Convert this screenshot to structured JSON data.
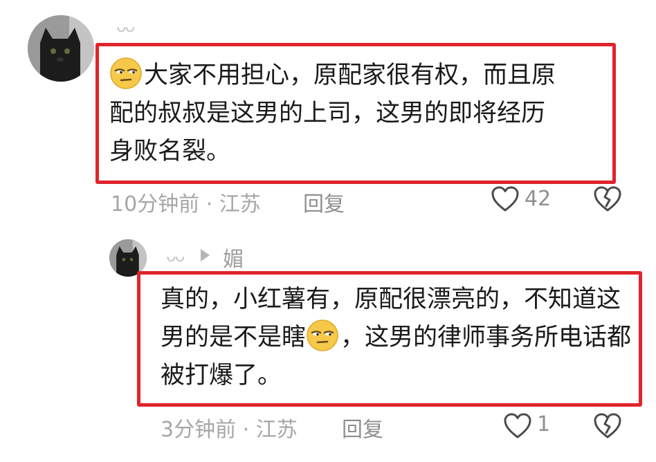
{
  "comment": {
    "author_mark": "ᴗᴗ",
    "text_lines": [
      "大家不用担心，原配家很有权，而且原",
      "配的叔叔是这男的上司，这男的即将经历",
      "身败名裂。"
    ],
    "time": "10分钟前 · 江苏",
    "reply_label": "回复",
    "likes": "42",
    "emoji": "smirk-face-icon"
  },
  "reply": {
    "author_mark": "ᴗᴗ",
    "reply_to": "媚",
    "text_before_emoji": "真的，小红薯有，原配很漂亮的，不知道这男的是不是瞎",
    "text_after_emoji": "，这男的律师事务所电话都被打爆了。",
    "time": "3分钟前 · 江苏",
    "reply_label": "回复",
    "likes": "1",
    "emoji": "smirk-face-icon"
  },
  "colors": {
    "highlight_border": "#e0242c",
    "meta_text": "#a6a6a6"
  }
}
